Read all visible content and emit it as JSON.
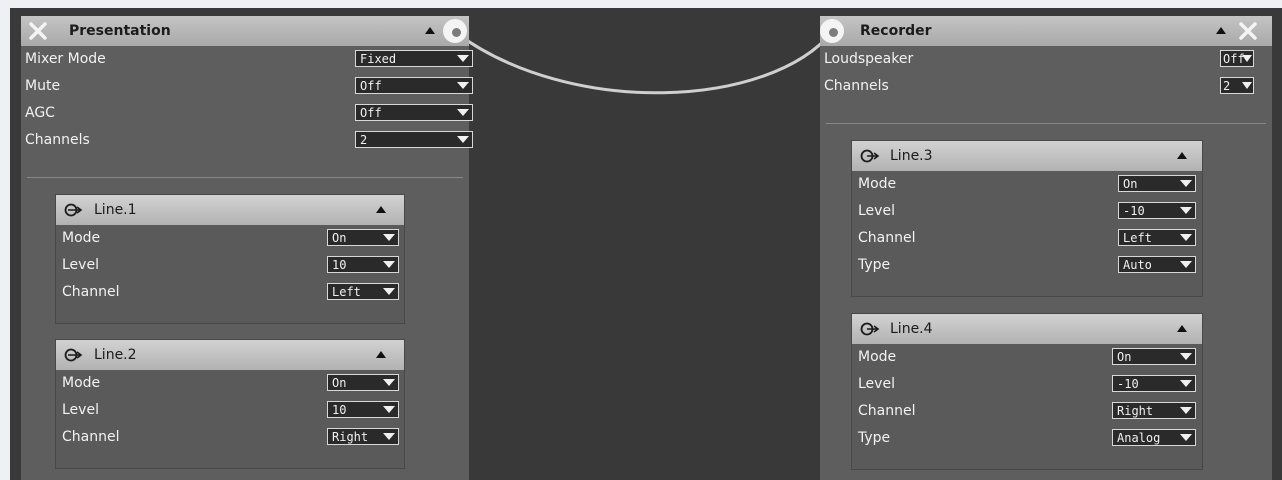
{
  "presentation": {
    "title": "Presentation",
    "props": [
      {
        "label": "Mixer Mode",
        "value": "Fixed"
      },
      {
        "label": "Mute",
        "value": "Off"
      },
      {
        "label": "AGC",
        "value": "Off"
      },
      {
        "label": "Channels",
        "value": "2"
      }
    ],
    "lines": [
      {
        "title": "Line.1",
        "props": [
          {
            "label": "Mode",
            "value": "On"
          },
          {
            "label": "Level",
            "value": "10"
          },
          {
            "label": "Channel",
            "value": "Left"
          }
        ]
      },
      {
        "title": "Line.2",
        "props": [
          {
            "label": "Mode",
            "value": "On"
          },
          {
            "label": "Level",
            "value": "10"
          },
          {
            "label": "Channel",
            "value": "Right"
          }
        ]
      }
    ]
  },
  "recorder": {
    "title": "Recorder",
    "props": [
      {
        "label": "Loudspeaker",
        "value": "Off"
      },
      {
        "label": "Channels",
        "value": "2"
      }
    ],
    "lines": [
      {
        "title": "Line.3",
        "props": [
          {
            "label": "Mode",
            "value": "On"
          },
          {
            "label": "Level",
            "value": "-10"
          },
          {
            "label": "Channel",
            "value": "Left"
          },
          {
            "label": "Type",
            "value": "Auto"
          }
        ]
      },
      {
        "title": "Line.4",
        "props": [
          {
            "label": "Mode",
            "value": "On"
          },
          {
            "label": "Level",
            "value": "-10"
          },
          {
            "label": "Channel",
            "value": "Right"
          },
          {
            "label": "Type",
            "value": "Analog"
          }
        ]
      }
    ]
  },
  "icons": {
    "close": "close-icon",
    "collapse": "triangle-up-icon",
    "port": "connector-port-icon",
    "line_input": "line-input-icon",
    "line_output": "line-output-icon"
  }
}
